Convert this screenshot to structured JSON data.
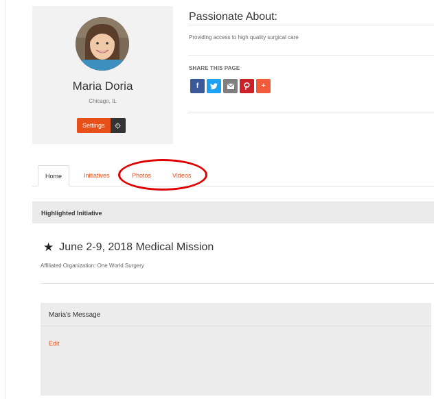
{
  "profile": {
    "name": "Maria Doria",
    "location": "Chicago, IL",
    "settings_label": "Settings"
  },
  "passion": {
    "title": "Passionate About:",
    "text": "Providing access to high quality surgical care"
  },
  "share": {
    "label": "SHARE THIS PAGE",
    "buttons": [
      {
        "icon": "facebook-icon",
        "glyph": "f",
        "color": "#3b5998"
      },
      {
        "icon": "twitter-icon",
        "glyph": "t",
        "color": "#1da1f2"
      },
      {
        "icon": "email-icon",
        "glyph": "✉",
        "color": "#7f7f7f"
      },
      {
        "icon": "pinterest-icon",
        "glyph": "P",
        "color": "#cb2027"
      },
      {
        "icon": "plus-icon",
        "glyph": "+",
        "color": "#f05c3b"
      }
    ]
  },
  "tabs": [
    {
      "label": "Home"
    },
    {
      "label": "Initiatives"
    },
    {
      "label": "Photos"
    },
    {
      "label": "Videos"
    }
  ],
  "highlighted": {
    "header": "Highlighted Initiative",
    "title": "June 2-9, 2018 Medical Mission",
    "affiliated": "Affiliated Organization: One World Surgery"
  },
  "message": {
    "title": "Maria's Message",
    "edit_label": "Edit"
  },
  "colors": {
    "accent": "#e8501a",
    "annotation": "#e00000"
  }
}
